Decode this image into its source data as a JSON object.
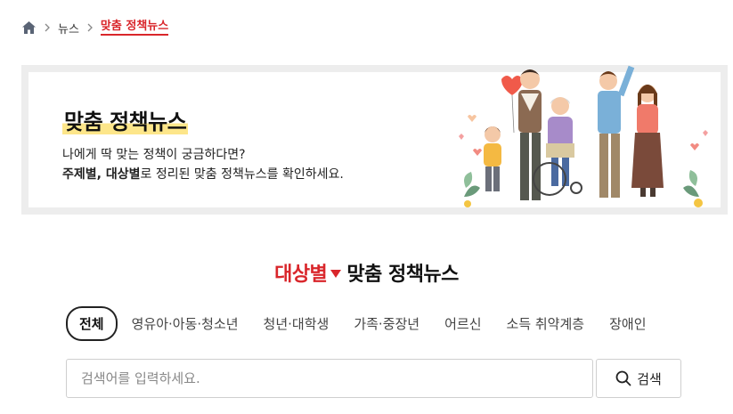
{
  "breadcrumb": {
    "home_icon": "home-icon",
    "items": [
      "뉴스",
      "맞춤 정책뉴스"
    ]
  },
  "banner": {
    "title": "맞춤 정책뉴스",
    "line1": "나에게 딱 맞는 정책이 궁금하다면?",
    "line2_bold": "주제별, 대상별",
    "line2_rest": "로 정리된 맞춤 정책뉴스를 확인하세요."
  },
  "section": {
    "title_red": "대상별",
    "title_rest": "맞춤 정책뉴스"
  },
  "tabs": [
    "전체",
    "영유아·아동·청소년",
    "청년·대학생",
    "가족·중장년",
    "어르신",
    "소득 취약계층",
    "장애인"
  ],
  "active_tab": "전체",
  "search": {
    "placeholder": "검색어를 입력하세요.",
    "button_label": "검색"
  },
  "colors": {
    "accent": "#d9262b",
    "highlight": "#fde68a"
  }
}
